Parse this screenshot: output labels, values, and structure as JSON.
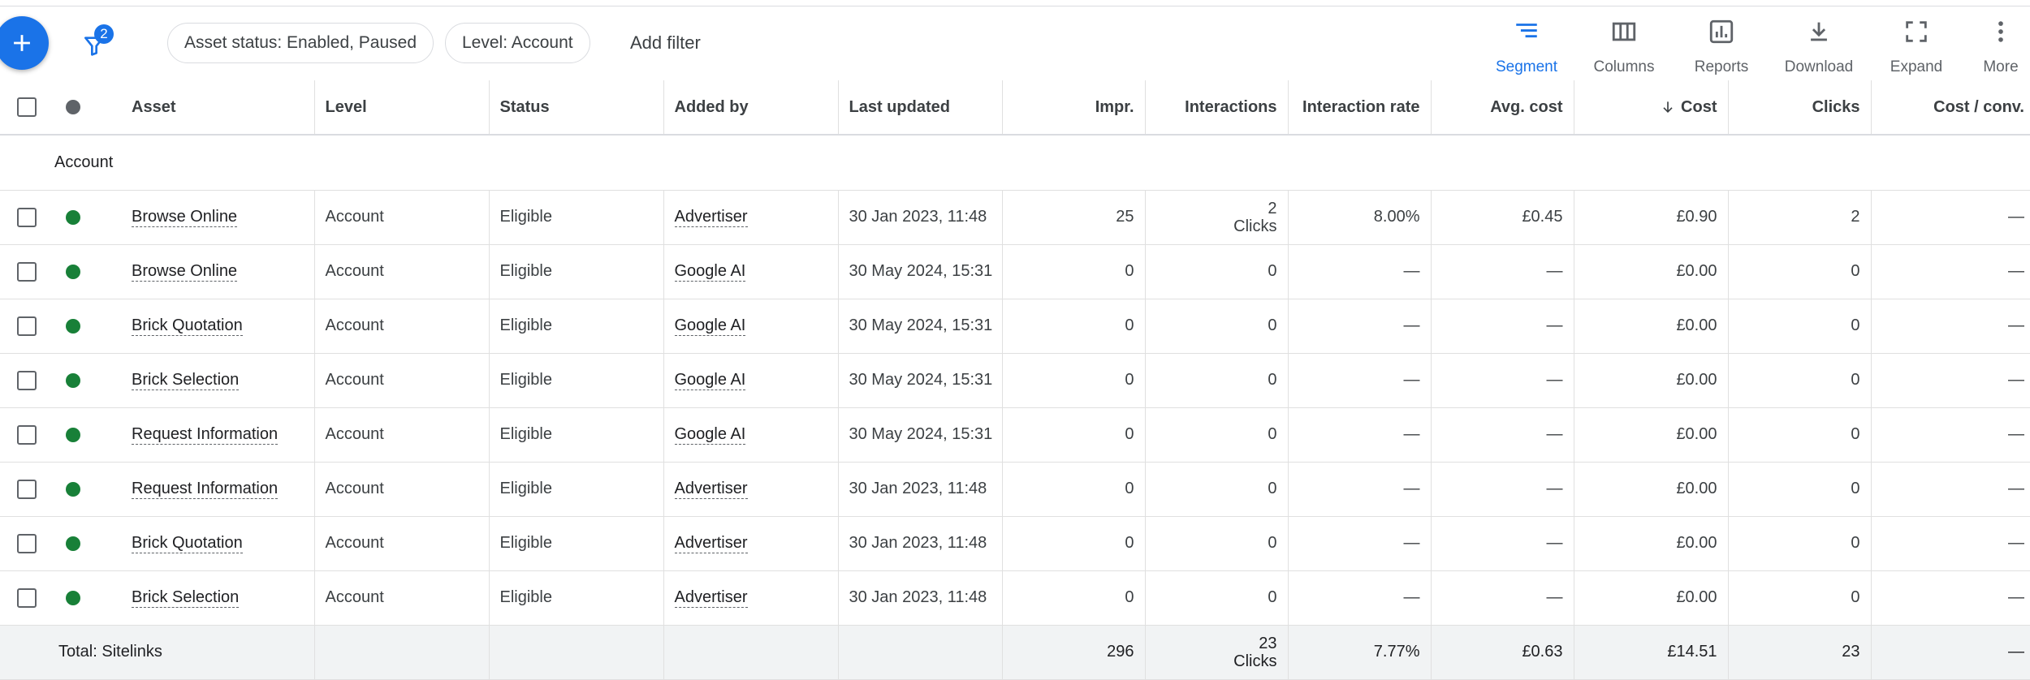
{
  "toolbar": {
    "filter_count": "2",
    "chips": [
      "Asset status: Enabled, Paused",
      "Level: Account"
    ],
    "add_filter": "Add filter",
    "actions": [
      {
        "label": "Segment",
        "icon": "segment-icon",
        "active": true
      },
      {
        "label": "Columns",
        "icon": "columns-icon"
      },
      {
        "label": "Reports",
        "icon": "reports-icon"
      },
      {
        "label": "Download",
        "icon": "download-icon"
      },
      {
        "label": "Expand",
        "icon": "expand-icon"
      },
      {
        "label": "More",
        "icon": "more-vertical-icon"
      }
    ]
  },
  "table": {
    "headers": {
      "asset": "Asset",
      "level": "Level",
      "status": "Status",
      "added_by": "Added by",
      "last_updated": "Last updated",
      "impr": "Impr.",
      "interactions": "Interactions",
      "interaction_rate": "Interaction rate",
      "avg_cost": "Avg. cost",
      "cost": "Cost",
      "clicks": "Clicks",
      "cost_conv": "Cost / conv."
    },
    "group_label": "Account",
    "rows": [
      {
        "asset": "Browse Online",
        "level": "Account",
        "status": "Eligible",
        "added_by": "Advertiser",
        "last_updated": "30 Jan 2023, 11:48",
        "impr": "25",
        "interactions": "2",
        "interactions_sub": "Clicks",
        "interaction_rate": "8.00%",
        "avg_cost": "£0.45",
        "cost": "£0.90",
        "clicks": "2",
        "cost_conv": "—"
      },
      {
        "asset": "Browse Online",
        "level": "Account",
        "status": "Eligible",
        "added_by": "Google AI",
        "last_updated": "30 May 2024, 15:31",
        "impr": "0",
        "interactions": "0",
        "interactions_sub": "",
        "interaction_rate": "—",
        "avg_cost": "—",
        "cost": "£0.00",
        "clicks": "0",
        "cost_conv": "—"
      },
      {
        "asset": "Brick Quotation",
        "level": "Account",
        "status": "Eligible",
        "added_by": "Google AI",
        "last_updated": "30 May 2024, 15:31",
        "impr": "0",
        "interactions": "0",
        "interactions_sub": "",
        "interaction_rate": "—",
        "avg_cost": "—",
        "cost": "£0.00",
        "clicks": "0",
        "cost_conv": "—"
      },
      {
        "asset": "Brick Selection",
        "level": "Account",
        "status": "Eligible",
        "added_by": "Google AI",
        "last_updated": "30 May 2024, 15:31",
        "impr": "0",
        "interactions": "0",
        "interactions_sub": "",
        "interaction_rate": "—",
        "avg_cost": "—",
        "cost": "£0.00",
        "clicks": "0",
        "cost_conv": "—"
      },
      {
        "asset": "Request Information",
        "level": "Account",
        "status": "Eligible",
        "added_by": "Google AI",
        "last_updated": "30 May 2024, 15:31",
        "impr": "0",
        "interactions": "0",
        "interactions_sub": "",
        "interaction_rate": "—",
        "avg_cost": "—",
        "cost": "£0.00",
        "clicks": "0",
        "cost_conv": "—"
      },
      {
        "asset": "Request Information",
        "level": "Account",
        "status": "Eligible",
        "added_by": "Advertiser",
        "last_updated": "30 Jan 2023, 11:48",
        "impr": "0",
        "interactions": "0",
        "interactions_sub": "",
        "interaction_rate": "—",
        "avg_cost": "—",
        "cost": "£0.00",
        "clicks": "0",
        "cost_conv": "—"
      },
      {
        "asset": "Brick Quotation",
        "level": "Account",
        "status": "Eligible",
        "added_by": "Advertiser",
        "last_updated": "30 Jan 2023, 11:48",
        "impr": "0",
        "interactions": "0",
        "interactions_sub": "",
        "interaction_rate": "—",
        "avg_cost": "—",
        "cost": "£0.00",
        "clicks": "0",
        "cost_conv": "—"
      },
      {
        "asset": "Brick Selection",
        "level": "Account",
        "status": "Eligible",
        "added_by": "Advertiser",
        "last_updated": "30 Jan 2023, 11:48",
        "impr": "0",
        "interactions": "0",
        "interactions_sub": "",
        "interaction_rate": "—",
        "avg_cost": "—",
        "cost": "£0.00",
        "clicks": "0",
        "cost_conv": "—"
      }
    ],
    "total": {
      "label": "Total: Sitelinks",
      "impr": "296",
      "interactions": "23",
      "interactions_sub": "Clicks",
      "interaction_rate": "7.77%",
      "avg_cost": "£0.63",
      "cost": "£14.51",
      "clicks": "23",
      "cost_conv": "—"
    }
  },
  "colors": {
    "accent": "#1a73e8",
    "status_enabled": "#188038",
    "header_dot": "#5f6368"
  }
}
